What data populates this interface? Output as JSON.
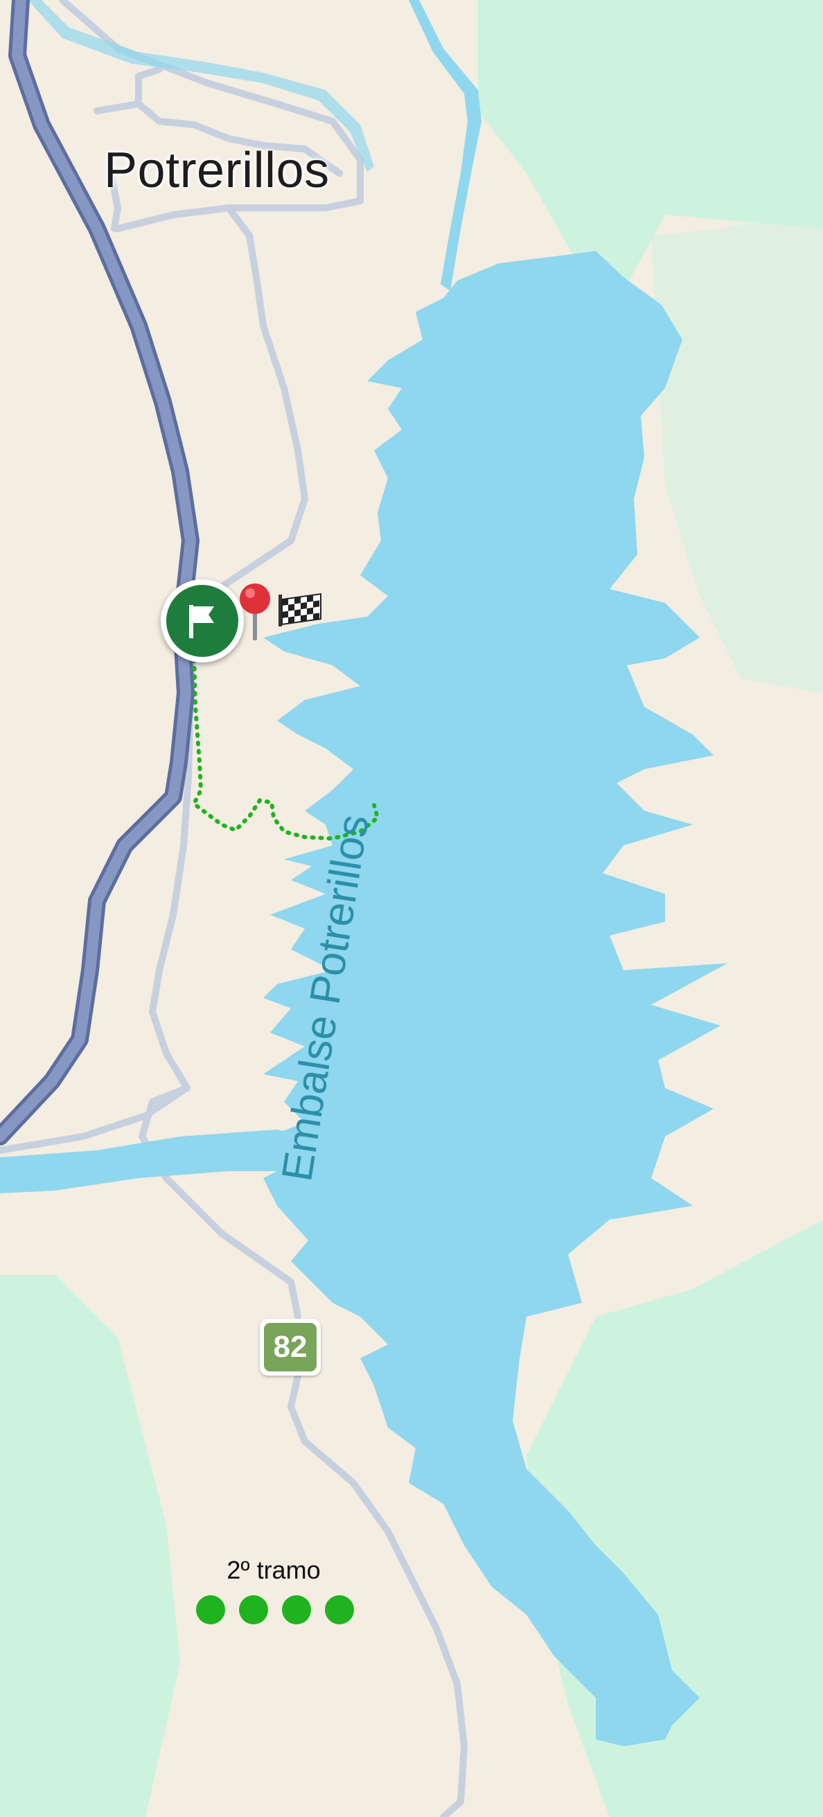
{
  "map": {
    "town_label": "Potrerillos",
    "lake_label": "Embalse Potrerillos",
    "route_shield": "82",
    "colors": {
      "land": "#f3ede2",
      "park": "#cdf3df",
      "water": "#8ed7ee",
      "highway_fill": "#8797c4",
      "highway_casing": "#5d6e9e",
      "minor_road": "#c7d0de",
      "route_line": "#1fb31f",
      "start_marker": "#1e7d3c"
    },
    "markers": {
      "start": {
        "icon": "flag-icon"
      },
      "pin": {
        "icon": "map-pin-icon"
      },
      "finish": {
        "icon": "checkered-flag-icon"
      }
    },
    "legend": {
      "segment_label": "2º tramo",
      "dot_count": 4
    }
  }
}
